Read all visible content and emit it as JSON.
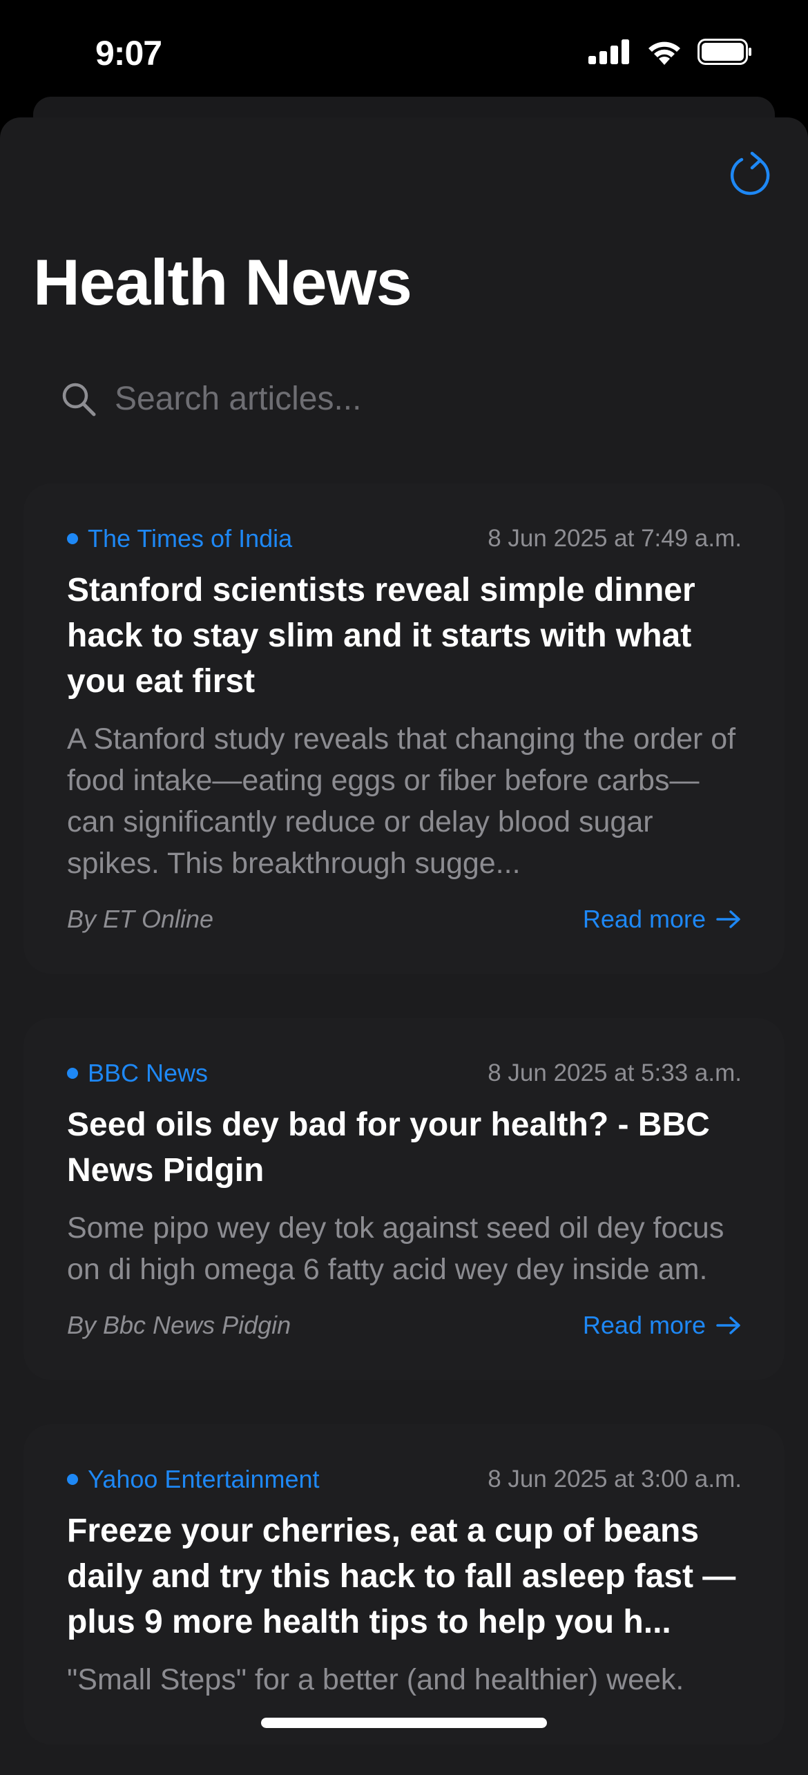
{
  "status": {
    "time": "9:07"
  },
  "header": {
    "title": "Health News"
  },
  "search": {
    "placeholder": "Search articles..."
  },
  "articles": [
    {
      "source": "The Times of India",
      "date": "8 Jun 2025 at 7:49 a.m.",
      "headline": "Stanford scientists reveal simple dinner hack to stay slim and it starts with what you eat first",
      "summary": "A Stanford study reveals that changing the order of food intake—eating eggs or fiber before carbs—can significantly reduce or delay blood sugar spikes. This breakthrough sugge...",
      "author": "By ET Online",
      "read_more": "Read more"
    },
    {
      "source": "BBC News",
      "date": "8 Jun 2025 at 5:33 a.m.",
      "headline": "Seed oils dey bad for your health? - BBC News Pidgin",
      "summary": "Some pipo wey dey tok against seed oil dey focus on di high omega 6 fatty acid wey dey inside am.",
      "author": "By Bbc News Pidgin",
      "read_more": "Read more"
    },
    {
      "source": "Yahoo Entertainment",
      "date": "8 Jun 2025 at 3:00 a.m.",
      "headline": "Freeze your cherries, eat a cup of beans daily and try this hack to fall asleep fast — plus 9 more health tips to help you h...",
      "summary": "\"Small Steps\" for a better (and healthier) week.",
      "author": "",
      "read_more": ""
    }
  ],
  "colors": {
    "accent": "#1e88f5",
    "background": "#1c1c1e",
    "card": "#1e1e20"
  }
}
